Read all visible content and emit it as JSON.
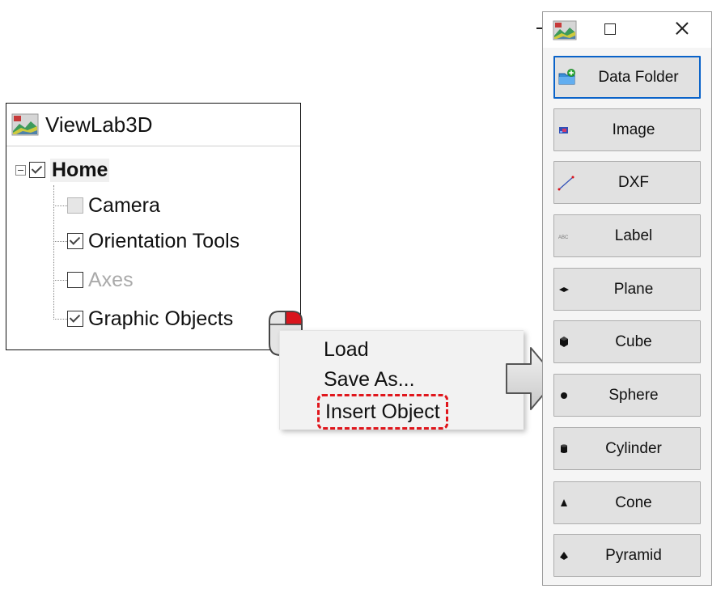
{
  "tree": {
    "title": "ViewLab3D",
    "root": {
      "label": "Home",
      "checked": true,
      "expanded": true
    },
    "children": [
      {
        "label": "Camera",
        "state": "disabled"
      },
      {
        "label": "Orientation Tools",
        "state": "checked"
      },
      {
        "label": "Axes",
        "state": "unchecked-dim"
      },
      {
        "label": "Graphic Objects",
        "state": "checked"
      }
    ]
  },
  "context_menu": {
    "items": [
      "Load",
      "Save As...",
      "Insert Object"
    ],
    "highlight_color": "#e0161c"
  },
  "toolbox": {
    "buttons": [
      {
        "label": "Data Folder",
        "icon": "folder-add-icon"
      },
      {
        "label": "Image",
        "icon": "image-icon"
      },
      {
        "label": "DXF",
        "icon": "dxf-line-icon"
      },
      {
        "label": "Label",
        "icon": "label-text-icon"
      },
      {
        "label": "Plane",
        "icon": "plane-icon"
      },
      {
        "label": "Cube",
        "icon": "cube-icon"
      },
      {
        "label": "Sphere",
        "icon": "sphere-icon"
      },
      {
        "label": "Cylinder",
        "icon": "cylinder-icon"
      },
      {
        "label": "Cone",
        "icon": "cone-icon"
      },
      {
        "label": "Pyramid",
        "icon": "pyramid-icon"
      }
    ],
    "label_icon_text": "ABC",
    "focus_color": "#0a63c9"
  }
}
